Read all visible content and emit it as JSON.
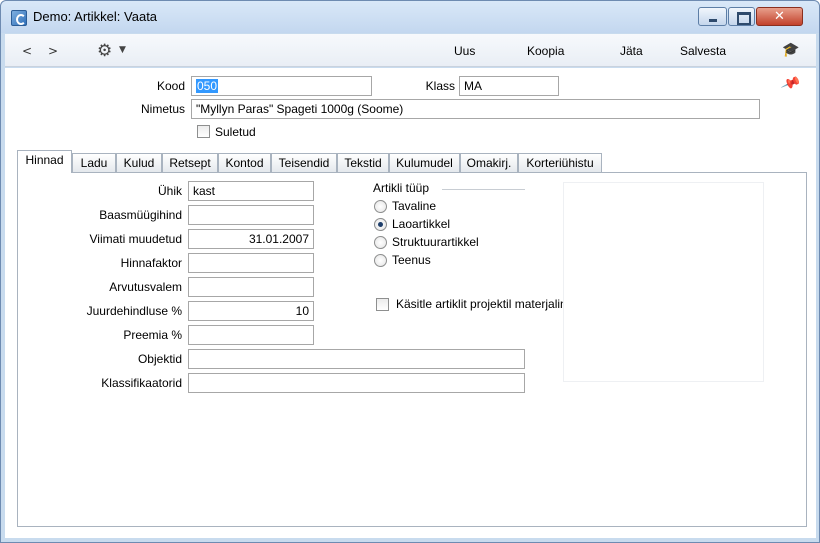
{
  "window": {
    "title": "Demo: Artikkel: Vaata"
  },
  "toolbar": {
    "back": "<",
    "forward": ">",
    "buttons": [
      "Uus",
      "Koopia",
      "Jäta",
      "Salvesta"
    ]
  },
  "header": {
    "kood_label": "Kood",
    "kood_value": "050",
    "klass_label": "Klass",
    "klass_value": "MA",
    "nimetus_label": "Nimetus",
    "nimetus_value": "\"Myllyn Paras\" Spageti 1000g  (Soome)",
    "suletud_label": "Suletud",
    "suletud_checked": false
  },
  "tabs": [
    "Hinnad",
    "Ladu",
    "Kulud",
    "Retsept",
    "Kontod",
    "Teisendid",
    "Tekstid",
    "Kulumudel",
    "Omakirj.",
    "Korteriühistu"
  ],
  "active_tab": "Hinnad",
  "form": {
    "uhik_label": "Ühik",
    "uhik_value": "kast",
    "baasmuugihind_label": "Baasmüügihind",
    "baasmuugihind_value": "",
    "viimati_label": "Viimati muudetud",
    "viimati_value": "31.01.2007",
    "hinnafaktor_label": "Hinnafaktor",
    "hinnafaktor_value": "",
    "arvutusvalem_label": "Arvutusvalem",
    "arvutusvalem_value": "",
    "juurdehindluse_label": "Juurdehindluse %",
    "juurdehindluse_value": "10",
    "preemia_label": "Preemia %",
    "preemia_value": "",
    "objektid_label": "Objektid",
    "objektid_value": "",
    "klassifikaatorid_label": "Klassifikaatorid",
    "klassifikaatorid_value": ""
  },
  "artikli_tuup": {
    "label": "Artikli tüüp",
    "options": [
      "Tavaline",
      "Laoartikkel",
      "Struktuurartikkel",
      "Teenus"
    ],
    "selected": "Laoartikkel"
  },
  "projekt_checkbox": {
    "label": "Käsitle artiklit projektil materjalina",
    "checked": false
  },
  "icons": [
    "app-icon",
    "gear-icon",
    "graduation-cap-icon",
    "pin-icon"
  ]
}
